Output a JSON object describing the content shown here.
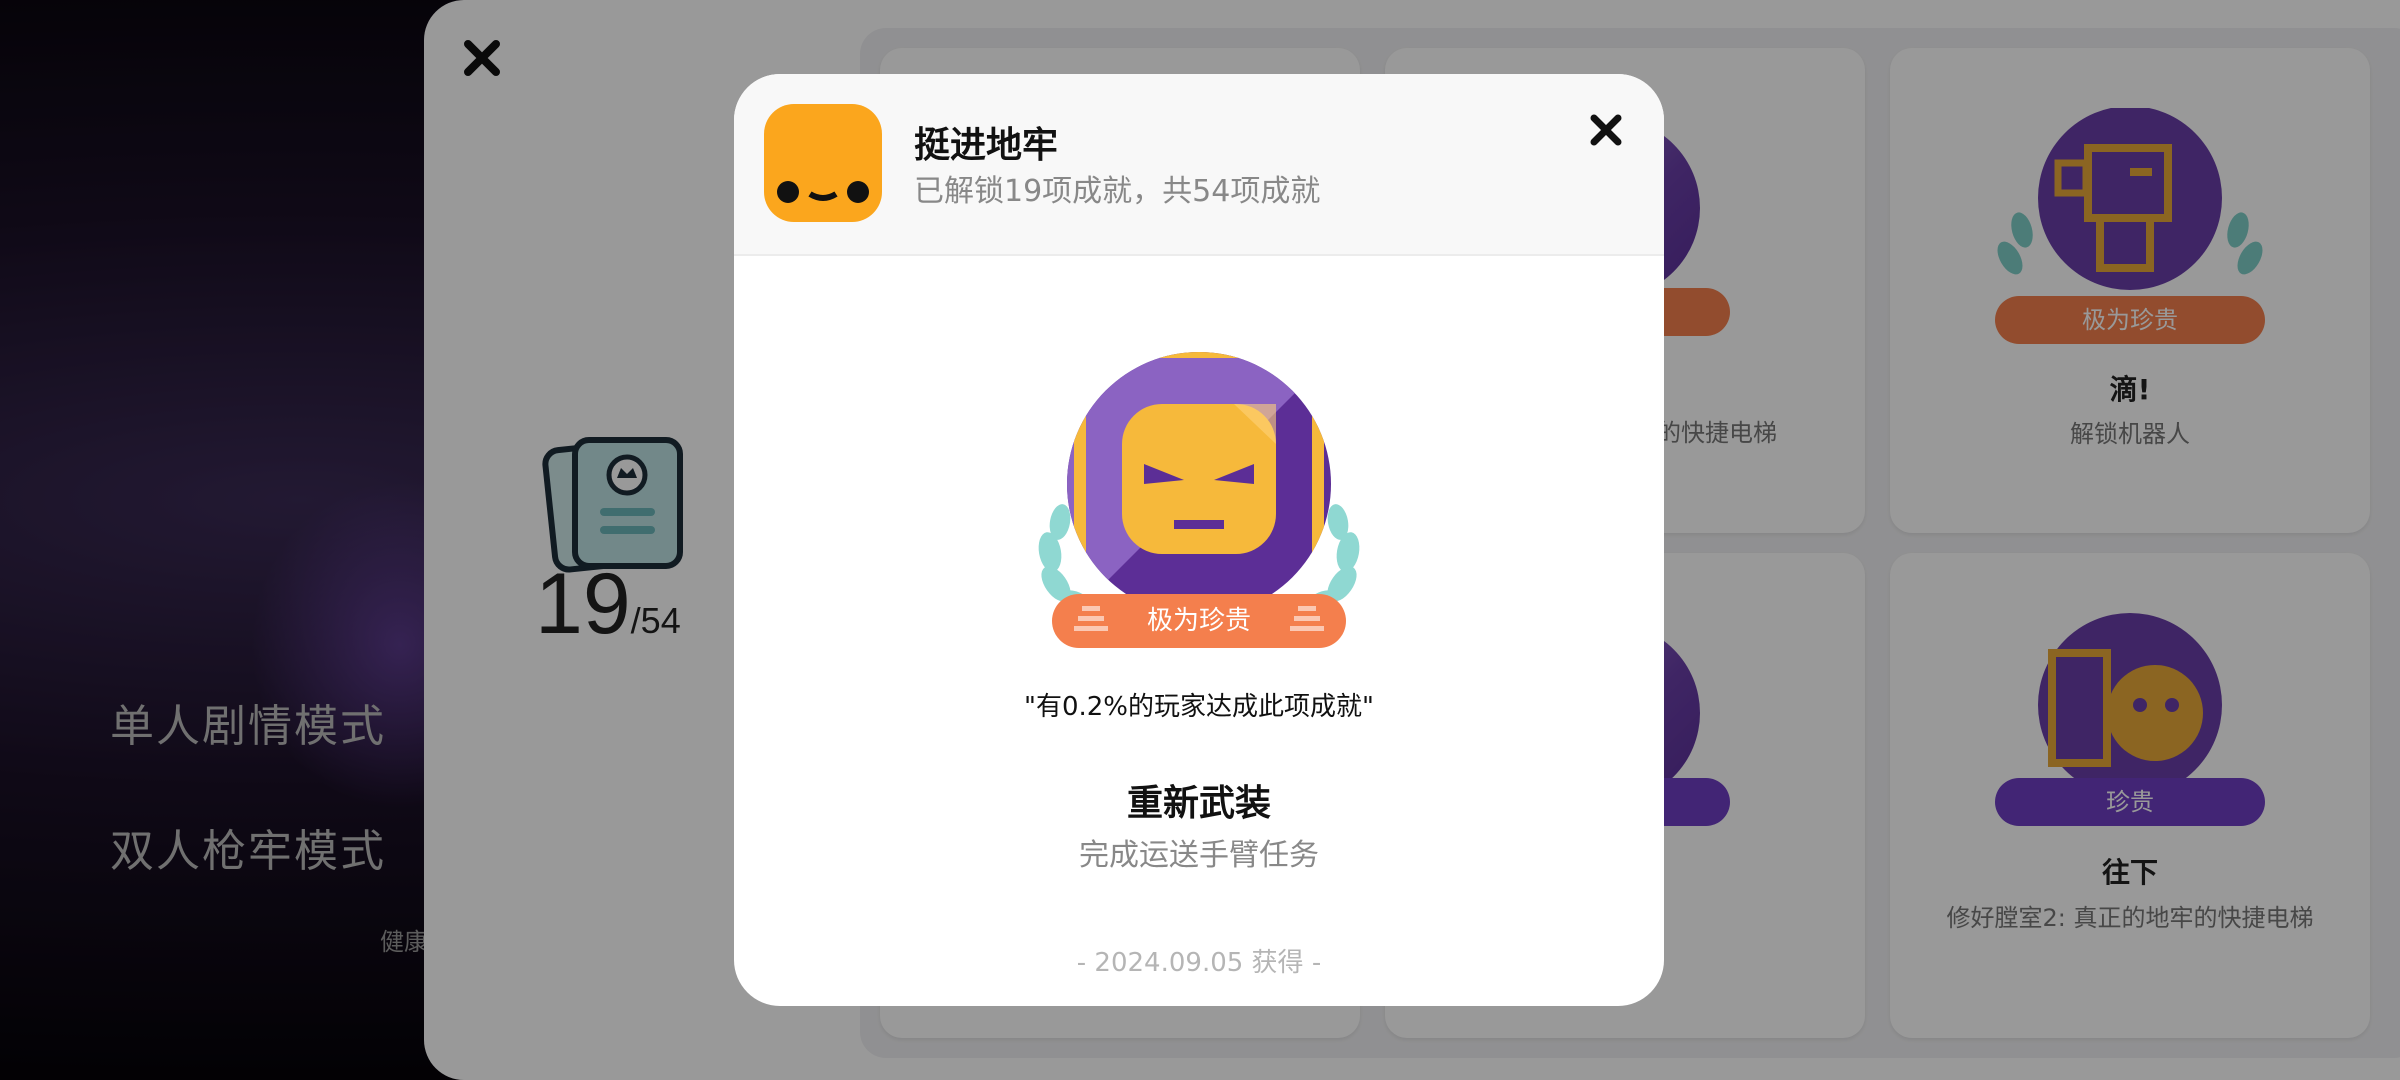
{
  "menu": {
    "items": [
      {
        "label": "单人剧情模式"
      },
      {
        "label": "双人枪牢模式"
      }
    ],
    "sub_label": "健康"
  },
  "panel": {
    "progress": {
      "unlocked": "19",
      "total": "/54"
    },
    "cards": [
      {
        "title": "",
        "desc": "",
        "rarity": ""
      },
      {
        "title": "",
        "desc": "广的快捷电梯",
        "rarity": ""
      },
      {
        "title": "滴!",
        "desc": "解锁机器人",
        "rarity": "极为珍贵"
      },
      {
        "title": "",
        "desc": "",
        "rarity": ""
      },
      {
        "title": "",
        "desc": "",
        "rarity": ""
      },
      {
        "title": "往下",
        "desc": "修好膛室2: 真正的地牢的快捷电梯",
        "rarity": "珍贵"
      }
    ]
  },
  "modal": {
    "game_title": "挺进地牢",
    "game_subtitle": "已解锁19项成就，共54项成就",
    "badge_rarity": "极为珍贵",
    "rarity_text": "\"有0.2%的玩家达成此项成就\"",
    "achievement_title": "重新武装",
    "achievement_desc": "完成运送手臂任务",
    "date": "- 2024.09.05 获得 -"
  },
  "colors": {
    "accent_orange": "#f47f4d",
    "accent_purple": "#6e3fc4",
    "game_icon": "#fba61d",
    "badge_purple": "#6a3fa8"
  },
  "icons": [
    "close-icon",
    "achievement-cards-icon",
    "game-icon",
    "laurel-icon"
  ]
}
